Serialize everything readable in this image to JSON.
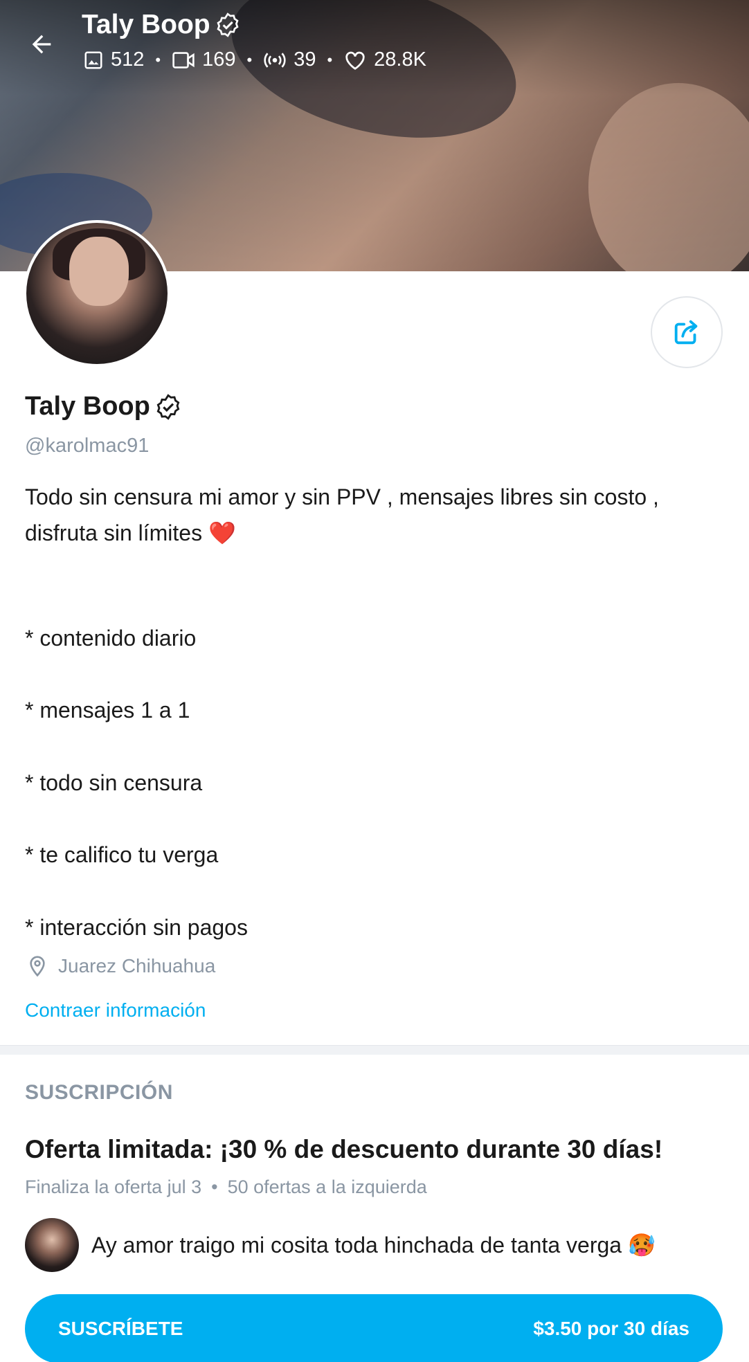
{
  "header": {
    "name": "Taly Boop",
    "stats": {
      "photos": "512",
      "videos": "169",
      "streams": "39",
      "likes": "28.8K"
    }
  },
  "profile": {
    "name": "Taly Boop",
    "handle": "@karolmac91",
    "bio_line1": "Todo sin censura mi amor y sin PPV , mensajes libres sin costo ,",
    "bio_line2": "disfruta sin límites ❤️",
    "bio_items": [
      "* contenido diario",
      "* mensajes 1 a 1",
      "* todo sin censura",
      "* te califico tu verga",
      "* interacción sin pagos"
    ],
    "location": "Juarez Chihuahua",
    "collapse_link": "Contraer información"
  },
  "subscription": {
    "heading": "SUSCRIPCIÓN",
    "offer_title": "Oferta limitada: ¡30 % de descuento durante 30 días!",
    "offer_end": "Finaliza la oferta jul 3",
    "offers_left": "50 ofertas a la izquierda",
    "message": "Ay amor traigo mi cosita toda hinchada de tanta verga 🥵",
    "button_label": "SUSCRÍBETE",
    "button_price": "$3.50 por 30 días"
  },
  "colors": {
    "accent": "#00aff0",
    "muted_text": "#8a96a3",
    "text": "#1a1a1a"
  },
  "icons": [
    "back-arrow-icon",
    "verified-badge-icon",
    "image-icon",
    "video-icon",
    "live-stream-icon",
    "heart-icon",
    "share-icon",
    "location-pin-icon"
  ]
}
